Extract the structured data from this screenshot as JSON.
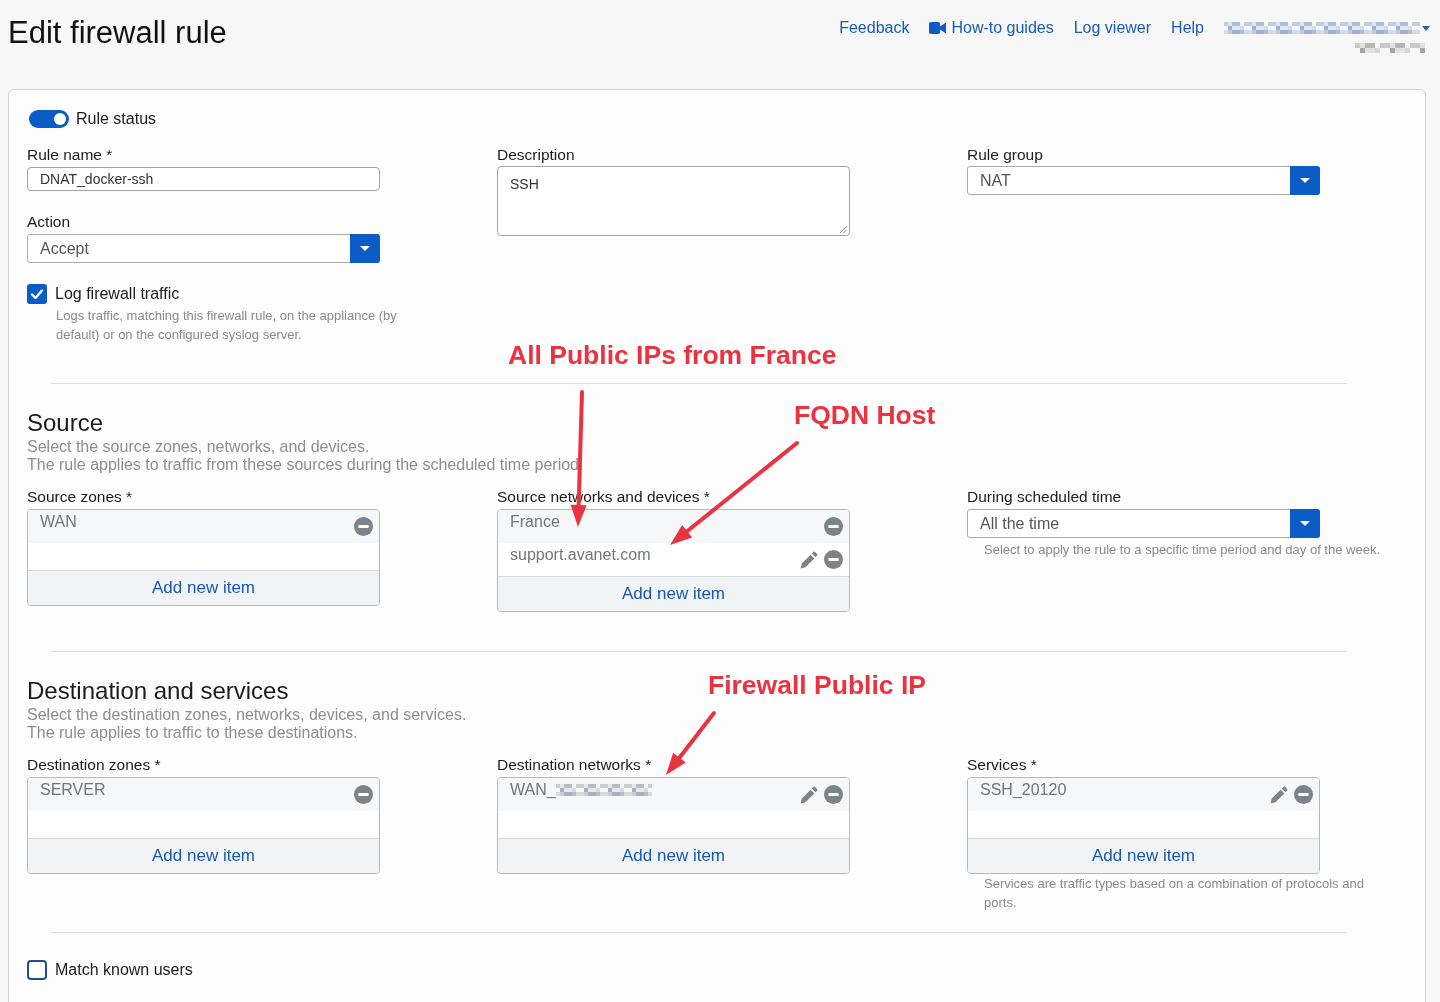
{
  "page": {
    "title": "Edit firewall rule"
  },
  "header_links": [
    {
      "label": "Feedback",
      "kind": "link"
    },
    {
      "label": "How-to guides",
      "kind": "video"
    },
    {
      "label": "Log viewer",
      "kind": "link"
    },
    {
      "label": "Help",
      "kind": "link"
    }
  ],
  "general": {
    "rule_status": {
      "label": "Rule status",
      "on": true
    },
    "rule_name": {
      "label": "Rule name *",
      "value": "DNAT_docker-ssh"
    },
    "action": {
      "label": "Action",
      "value": "Accept"
    },
    "log_traffic": {
      "label": "Log firewall traffic",
      "checked": true,
      "hint": "Logs traffic, matching this firewall rule, on the appliance (by default) or on the configured syslog server."
    },
    "description": {
      "label": "Description",
      "value": "SSH"
    },
    "rule_group": {
      "label": "Rule group",
      "value": "NAT"
    }
  },
  "sections": [
    {
      "title": "Source",
      "description": [
        "Select the source zones, networks, and devices.",
        "The rule applies to traffic from these sources during the scheduled time period."
      ],
      "fields": [
        {
          "kind": "list",
          "label": "Source zones *",
          "items": [
            {
              "text": "WAN",
              "editable": false
            }
          ],
          "add_label": "Add new item"
        },
        {
          "kind": "list",
          "label": "Source networks and devices *",
          "items": [
            {
              "text": "France",
              "editable": false
            },
            {
              "text": "support.avanet.com",
              "editable": true
            }
          ],
          "add_label": "Add new item"
        },
        {
          "kind": "select",
          "label": "During scheduled time",
          "value": "All the time",
          "hint": "Select to apply the rule to a specific time period and day of the week."
        }
      ]
    },
    {
      "title": "Destination and services",
      "description": [
        "Select the destination zones, networks, devices, and services.",
        "The rule applies to traffic to these destinations."
      ],
      "fields": [
        {
          "kind": "list",
          "label": "Destination zones *",
          "items": [
            {
              "text": "SERVER",
              "editable": false
            }
          ],
          "add_label": "Add new item"
        },
        {
          "kind": "list",
          "label": "Destination networks *",
          "items": [
            {
              "text": "WAN_",
              "editable": true,
              "redacted": true
            }
          ],
          "add_label": "Add new item"
        },
        {
          "kind": "list",
          "label": "Services *",
          "items": [
            {
              "text": "SSH_20120",
              "editable": true
            }
          ],
          "add_label": "Add new item",
          "hint": "Services are traffic types based on a combination of protocols and ports."
        }
      ]
    }
  ],
  "match_known_users": {
    "label": "Match known users",
    "checked": false
  },
  "annotations": [
    {
      "text": "All Public IPs from France"
    },
    {
      "text": "FQDN Host"
    },
    {
      "text": "Firewall Public IP"
    }
  ]
}
